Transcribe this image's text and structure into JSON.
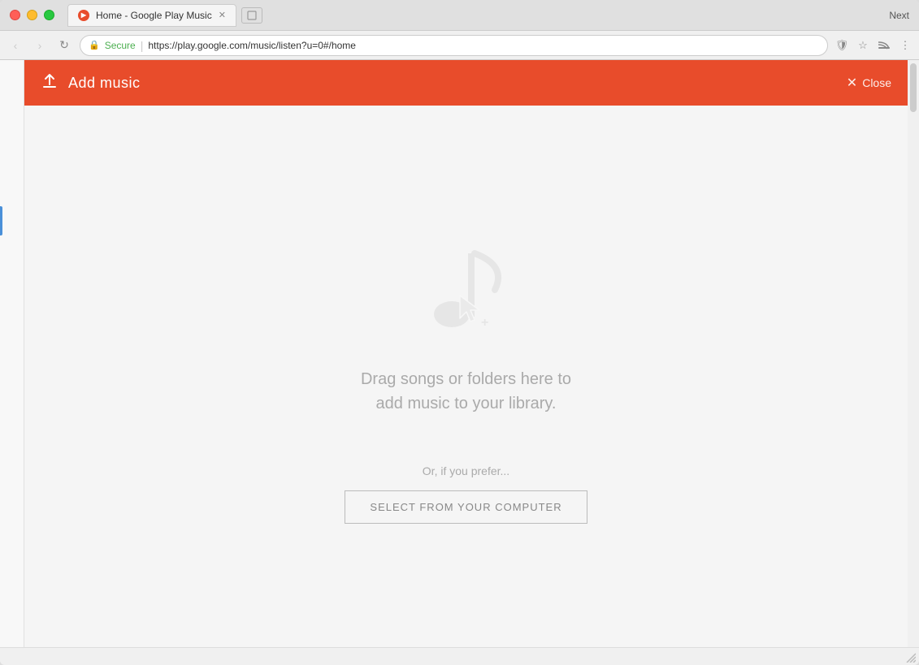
{
  "window": {
    "title": "Home - Google Play Music",
    "tab_label": "Home - Google Play Music",
    "next_label": "Next"
  },
  "addressbar": {
    "secure_label": "Secure",
    "url": "https://play.google.com/music/listen?u=0#/home",
    "back_icon": "◀",
    "forward_icon": "▶",
    "refresh_icon": "↻"
  },
  "modal": {
    "title": "Add music",
    "close_label": "Close",
    "drag_text_line1": "Drag songs or folders here to",
    "drag_text_line2": "add music to your library.",
    "prefer_text": "Or, if you prefer...",
    "select_button_label": "SELECT FROM YOUR COMPUTER"
  }
}
